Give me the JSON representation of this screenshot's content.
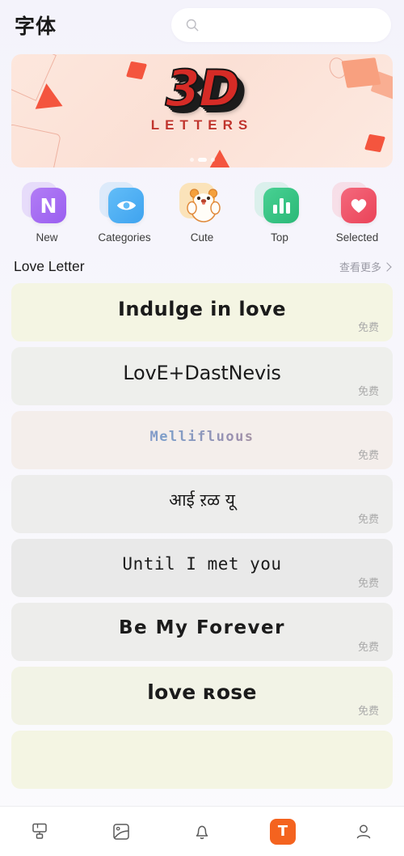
{
  "header": {
    "title": "字体",
    "search_placeholder": "",
    "search_value": "",
    "search_icon": "search-icon"
  },
  "banner": {
    "title_3d": "3D",
    "subtitle": "LETTERS",
    "dots_count": 3,
    "active_dot": 1,
    "bg_color": "#fde7dd",
    "text_color": "#d62b26"
  },
  "shortcuts": [
    {
      "label": "New",
      "icon": "letter-n-icon",
      "color": "#a06bf0",
      "color2": "#bb7ef6",
      "glyph": "N"
    },
    {
      "label": "Categories",
      "icon": "eye-icon",
      "color": "#44a6f0",
      "color2": "#62bdf8",
      "glyph": ""
    },
    {
      "label": "Cute",
      "icon": "hamster-icon",
      "color": "#fbd9a0",
      "color2": "#fce3b6",
      "glyph": ""
    },
    {
      "label": "Top",
      "icon": "bar-chart-icon",
      "color": "#2ec07f",
      "color2": "#49d496",
      "glyph": ""
    },
    {
      "label": "Selected",
      "icon": "heart-icon",
      "color": "#ef4d63",
      "color2": "#f4687c",
      "glyph": ""
    }
  ],
  "section": {
    "title": "Love Letter",
    "more_label": "查看更多"
  },
  "font_cards": [
    {
      "sample": "Indulge in love",
      "price": "免费",
      "bg": "#f4f5e3",
      "style": "f-rounded"
    },
    {
      "sample": "LovE+DastNevis",
      "price": "免费",
      "bg": "#eeefec",
      "style": "f-casual"
    },
    {
      "sample": "Mellifluous",
      "price": "免费",
      "bg": "#f4eeeb",
      "style": "f-deco"
    },
    {
      "sample": "आई ऱळ यू",
      "price": "免费",
      "bg": "#ededec",
      "style": "f-deva"
    },
    {
      "sample": "Until I met you",
      "price": "免费",
      "bg": "#e9e9e9",
      "style": "f-mono"
    },
    {
      "sample": "Be My Forever",
      "price": "免费",
      "bg": "#ededeb",
      "style": "f-wide"
    },
    {
      "sample": "love ʀose",
      "price": "免费",
      "bg": "#f2f3e6",
      "style": "f-lower"
    },
    {
      "sample": "",
      "price": "",
      "bg": "#f4f5e3",
      "style": "f-rounded"
    }
  ],
  "bottom_nav": [
    {
      "icon": "paint-roller-icon",
      "active": false
    },
    {
      "icon": "image-icon",
      "active": false
    },
    {
      "icon": "bell-icon",
      "active": false
    },
    {
      "icon": "font-t-icon",
      "active": true,
      "glyph": "T",
      "color": "#f4631f"
    },
    {
      "icon": "person-icon",
      "active": false
    }
  ]
}
